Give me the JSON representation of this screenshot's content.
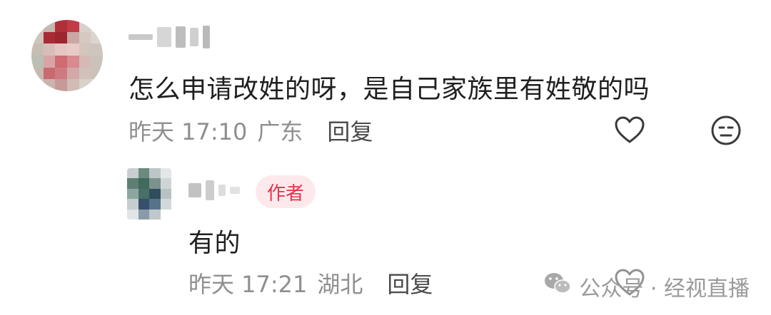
{
  "comment": {
    "text": "怎么申请改姓的呀，是自己家族里有姓敬的吗",
    "date": "昨天 17:10",
    "location": "广东",
    "reply_label": "回复"
  },
  "reply": {
    "badge": "作者",
    "text": "有的",
    "date": "昨天 17:21",
    "location": "湖北",
    "reply_label": "回复"
  },
  "watermark": {
    "text": "公众号 · 经视直播"
  },
  "icons": {
    "like": "heart-icon",
    "dislike": "meh-face-icon",
    "wechat": "wechat-icon"
  }
}
